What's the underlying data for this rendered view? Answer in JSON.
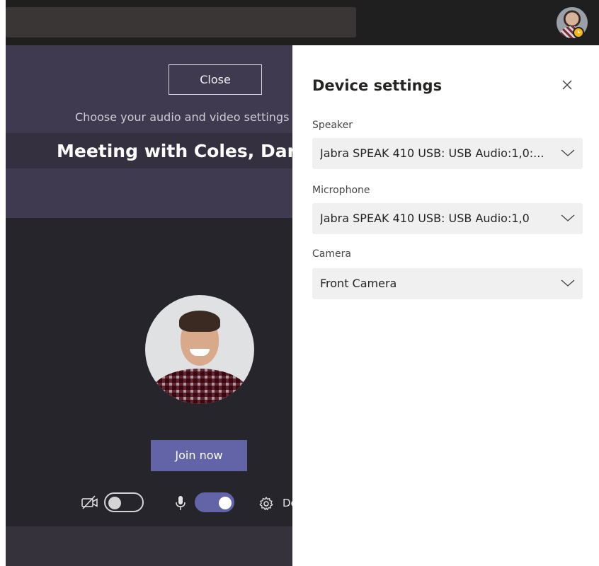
{
  "prejoin": {
    "close_label": "Close",
    "choose_text": "Choose your audio and video settings for",
    "meeting_title": "Meeting with Coles, Darren",
    "join_label": "Join now",
    "camera_on": false,
    "mic_on": true,
    "device_settings_label": "Device settings"
  },
  "panel": {
    "title": "Device settings",
    "speaker": {
      "label": "Speaker",
      "value": "Jabra SPEAK 410 USB: USB Audio:1,0:..."
    },
    "microphone": {
      "label": "Microphone",
      "value": "Jabra SPEAK 410 USB: USB Audio:1,0"
    },
    "camera": {
      "label": "Camera",
      "value": "Front Camera"
    }
  },
  "colors": {
    "accent": "#6264a7",
    "hero": "#403a50",
    "dark_bg": "#26252b",
    "topbar": "#1f1f1f",
    "presence_away": "#f8b70e"
  },
  "icons": {
    "close": "close-icon",
    "chevron": "chevron-down-icon",
    "camera_off": "camera-off-icon",
    "microphone": "microphone-icon",
    "settings": "gear-icon",
    "presence": "clock-icon"
  }
}
